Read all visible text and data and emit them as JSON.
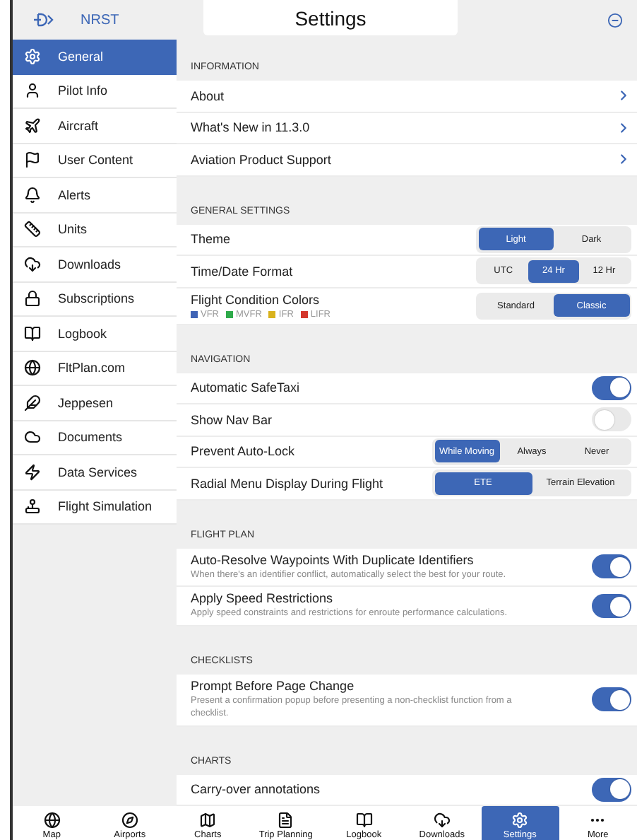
{
  "top_bar": {
    "nearest": "NRST",
    "title": "Settings"
  },
  "sidebar": {
    "items": [
      {
        "label": "General",
        "selected": true
      },
      {
        "label": "Pilot Info",
        "selected": false
      },
      {
        "label": "Aircraft",
        "selected": false
      },
      {
        "label": "User Content",
        "selected": false
      },
      {
        "label": "Alerts",
        "selected": false
      },
      {
        "label": "Units",
        "selected": false
      },
      {
        "label": "Downloads",
        "selected": false
      },
      {
        "label": "Subscriptions",
        "selected": false
      },
      {
        "label": "Logbook",
        "selected": false
      },
      {
        "label": "FltPlan.com",
        "selected": false
      },
      {
        "label": "Jeppesen",
        "selected": false
      },
      {
        "label": "Documents",
        "selected": false
      },
      {
        "label": "Data Services",
        "selected": false
      },
      {
        "label": "Flight Simulation",
        "selected": false
      }
    ]
  },
  "sections": [
    {
      "header": "INFORMATION",
      "rows": [
        {
          "kind": "link",
          "label": "About"
        },
        {
          "kind": "link",
          "label": "What's New in 11.3.0"
        },
        {
          "kind": "link",
          "label": "Aviation Product Support"
        }
      ]
    },
    {
      "header": "GENERAL SETTINGS",
      "rows": [
        {
          "kind": "segmented",
          "label": "Theme",
          "options": [
            {
              "label": "Light",
              "selected": true
            },
            {
              "label": "Dark",
              "selected": false
            }
          ]
        },
        {
          "kind": "segmented",
          "label": "Time/Date Format",
          "options": [
            {
              "label": "UTC",
              "selected": false
            },
            {
              "label": "24 Hr",
              "selected": true
            },
            {
              "label": "12 Hr",
              "selected": false
            }
          ]
        },
        {
          "kind": "segmented",
          "label": "Flight Condition Colors",
          "legend": [
            {
              "label": "VFR",
              "color": "#3f63b5"
            },
            {
              "label": "MVFR",
              "color": "#2eaa4a"
            },
            {
              "label": "IFR",
              "color": "#d9b21c"
            },
            {
              "label": "LIFR",
              "color": "#d4372c"
            }
          ],
          "options": [
            {
              "label": "Standard",
              "selected": false
            },
            {
              "label": "Classic",
              "selected": true
            }
          ]
        }
      ]
    },
    {
      "header": "NAVIGATION",
      "rows": [
        {
          "kind": "toggle",
          "label": "Automatic SafeTaxi",
          "on": true
        },
        {
          "kind": "toggle",
          "label": "Show Nav Bar",
          "on": false
        },
        {
          "kind": "wide_segmented",
          "label": "Prevent Auto-Lock",
          "options": [
            {
              "label": "While Moving",
              "selected": true
            },
            {
              "label": "Always",
              "selected": false
            },
            {
              "label": "Never",
              "selected": false
            }
          ]
        },
        {
          "kind": "wide_segmented",
          "label": "Radial Menu Display During Flight",
          "options": [
            {
              "label": "ETE",
              "selected": true
            },
            {
              "label": "Terrain Elevation",
              "selected": false
            }
          ]
        }
      ]
    },
    {
      "header": "FLIGHT PLAN",
      "rows": [
        {
          "kind": "toggle",
          "label": "Auto-Resolve Waypoints With Duplicate Identifiers",
          "description": "When there's an identifier conflict, automatically select the best for your route.",
          "on": true
        },
        {
          "kind": "toggle",
          "label": "Apply Speed Restrictions",
          "description": "Apply speed constraints and restrictions for enroute performance calculations.",
          "on": true
        }
      ]
    },
    {
      "header": "CHECKLISTS",
      "rows": [
        {
          "kind": "toggle",
          "label": "Prompt Before Page Change",
          "description": "Present a confirmation popup before presenting a non-checklist function from a checklist.",
          "on": true
        }
      ]
    },
    {
      "header": "CHARTS",
      "rows": [
        {
          "kind": "toggle",
          "label": "Carry-over annotations",
          "on": true
        }
      ]
    }
  ],
  "tab_bar": [
    {
      "label": "Map",
      "selected": false
    },
    {
      "label": "Airports",
      "selected": false
    },
    {
      "label": "Charts",
      "selected": false
    },
    {
      "label": "Trip Planning",
      "selected": false
    },
    {
      "label": "Logbook",
      "selected": false
    },
    {
      "label": "Downloads",
      "selected": false
    },
    {
      "label": "Settings",
      "selected": true
    },
    {
      "label": "More",
      "selected": false
    }
  ]
}
